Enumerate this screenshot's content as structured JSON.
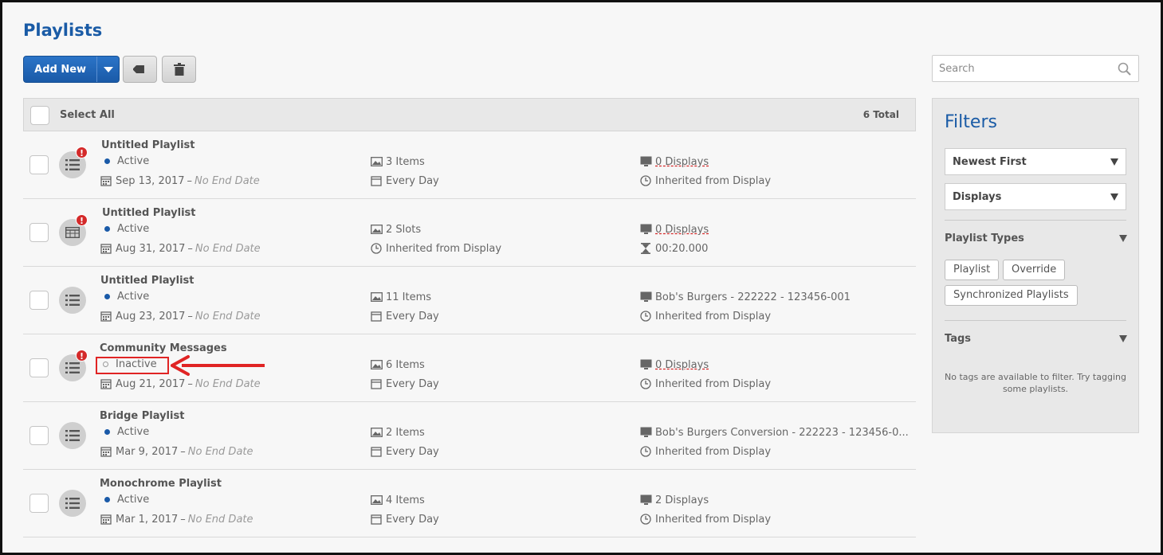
{
  "page": {
    "title": "Playlists"
  },
  "toolbar": {
    "add_new": "Add New"
  },
  "search": {
    "placeholder": "Search"
  },
  "list": {
    "select_all": "Select All",
    "total": "6 Total",
    "rows": [
      {
        "name": "Untitled Playlist",
        "status": "Active",
        "start_date": "Sep 13, 2017",
        "end": "No End Date",
        "content": "3 Items",
        "schedule": "Every Day",
        "target": "0 Displays",
        "timing": "Inherited from Display",
        "alert": "!"
      },
      {
        "name": "Untitled Playlist",
        "status": "Active",
        "start_date": "Aug 31, 2017",
        "end": "No End Date",
        "content": "2 Slots",
        "schedule": "Inherited from Display",
        "target": "0 Displays",
        "timing": "00:20.000",
        "alert": "!"
      },
      {
        "name": "Untitled Playlist",
        "status": "Active",
        "start_date": "Aug 23, 2017",
        "end": "No End Date",
        "content": "11 Items",
        "schedule": "Every Day",
        "target": "Bob's Burgers - 222222 - 123456-001",
        "timing": "Inherited from Display"
      },
      {
        "name": "Community Messages",
        "status": "Inactive",
        "start_date": "Aug 21, 2017",
        "end": "No End Date",
        "content": "6 Items",
        "schedule": "Every Day",
        "target": "0 Displays",
        "timing": "Inherited from Display",
        "alert": "!"
      },
      {
        "name": "Bridge Playlist",
        "status": "Active",
        "start_date": "Mar 9, 2017",
        "end": "No End Date",
        "content": "2 Items",
        "schedule": "Every Day",
        "target": "Bob's Burgers Conversion - 222223 - 123456-0...",
        "timing": "Inherited from Display"
      },
      {
        "name": "Monochrome Playlist",
        "status": "Active",
        "start_date": "Mar 1, 2017",
        "end": "No End Date",
        "content": "4 Items",
        "schedule": "Every Day",
        "target": "2 Displays",
        "timing": "Inherited from Display"
      }
    ],
    "date_separator": "–"
  },
  "filters": {
    "title": "Filters",
    "sort": "Newest First",
    "scope": "Displays",
    "playlist_types_label": "Playlist Types",
    "types": [
      "Playlist",
      "Override",
      "Synchronized Playlists"
    ],
    "tags_label": "Tags",
    "no_tags": "No tags are available to filter. Try tagging some playlists."
  },
  "colors": {
    "accent": "#1a5ba6",
    "annotation": "#e02424"
  }
}
